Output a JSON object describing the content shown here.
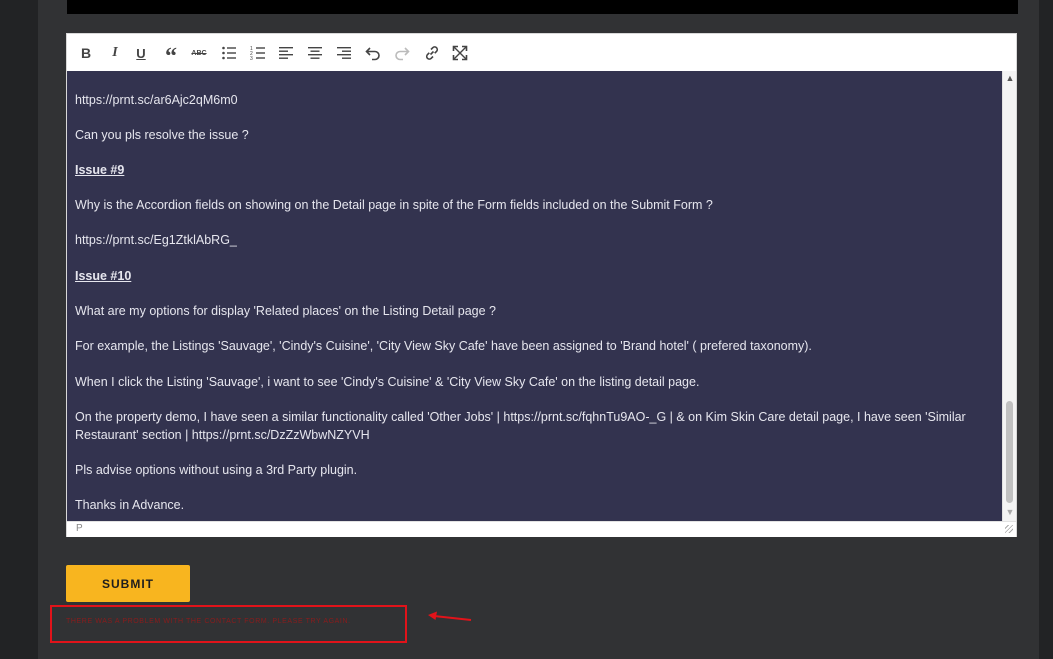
{
  "toolbar": {
    "buttons": [
      {
        "name": "bold-button",
        "icon": "bold-icon",
        "glyph": "B"
      },
      {
        "name": "italic-button",
        "icon": "italic-icon",
        "glyph": "I"
      },
      {
        "name": "underline-button",
        "icon": "underline-icon",
        "glyph": "U"
      },
      {
        "name": "blockquote-button",
        "icon": "quote-icon",
        "glyph": "“"
      },
      {
        "name": "strikethrough-button",
        "icon": "strikethrough-icon",
        "glyph": "ABC"
      },
      {
        "name": "bullet-list-button",
        "icon": "bullet-list-icon"
      },
      {
        "name": "numbered-list-button",
        "icon": "numbered-list-icon"
      },
      {
        "name": "align-left-button",
        "icon": "align-left-icon"
      },
      {
        "name": "align-center-button",
        "icon": "align-center-icon"
      },
      {
        "name": "align-right-button",
        "icon": "align-right-icon"
      },
      {
        "name": "undo-button",
        "icon": "undo-icon"
      },
      {
        "name": "redo-button",
        "icon": "redo-icon"
      },
      {
        "name": "link-button",
        "icon": "link-icon"
      },
      {
        "name": "fullscreen-button",
        "icon": "fullscreen-icon"
      }
    ]
  },
  "editor": {
    "paragraphs": [
      {
        "text": "https://prnt.sc/ar6Ajc2qM6m0",
        "type": "text"
      },
      {
        "text": "Can you pls resolve the issue ?",
        "type": "text"
      },
      {
        "text": "Issue #9",
        "type": "issue"
      },
      {
        "text": "Why is the Accordion fields on showing on the Detail page in spite of the Form fields included on the Submit Form ?",
        "type": "text"
      },
      {
        "text": "https://prnt.sc/Eg1ZtklAbRG_",
        "type": "text"
      },
      {
        "text": "Issue #10",
        "type": "issue"
      },
      {
        "text": "What are my options for display 'Related places' on the Listing Detail page ?",
        "type": "text"
      },
      {
        "text": "For example, the Listings 'Sauvage', 'Cindy's Cuisine', 'City View Sky Cafe' have been assigned to 'Brand hotel' ( prefered taxonomy).",
        "type": "text"
      },
      {
        "text": "When I click the Listing 'Sauvage', i want to see 'Cindy's Cuisine' &  'City View Sky Cafe' on the listing detail page.",
        "type": "text"
      },
      {
        "text": "On the property demo, I have seen a similar functionality called 'Other Jobs' | https://prnt.sc/fqhnTu9AO-_G | & on Kim Skin Care detail page, I have seen 'Similar Restaurant' section | https://prnt.sc/DzZzWbwNZYVH",
        "type": "text"
      },
      {
        "text": "Pls advise options without using a 3rd Party plugin.",
        "type": "text"
      },
      {
        "text": " Thanks in Advance.",
        "type": "text"
      }
    ],
    "status_path": "P"
  },
  "form": {
    "submit_label": "SUBMIT",
    "error_message": "THERE WAS A PROBLEM WITH THE CONTACT FORM. PLEASE TRY AGAIN."
  },
  "colors": {
    "editor_background": "#33334f",
    "submit_button": "#f8b51f",
    "error_outline": "#e1131a"
  }
}
